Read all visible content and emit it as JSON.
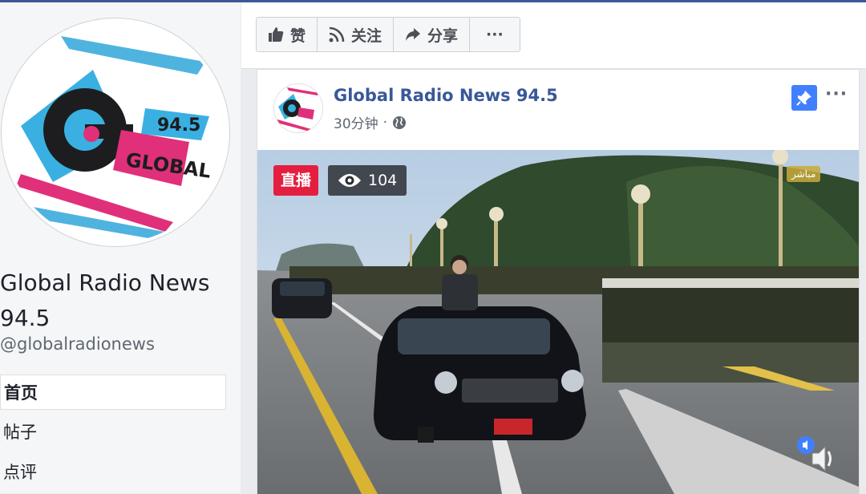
{
  "page": {
    "name": "Global Radio News 94.5",
    "handle": "@globalradionews",
    "logo_text": "GLOBAL",
    "logo_number": "94.5"
  },
  "nav": {
    "items": [
      {
        "label": "首页",
        "active": true
      },
      {
        "label": "帖子",
        "active": false
      },
      {
        "label": "点评",
        "active": false
      }
    ]
  },
  "actions": {
    "like": "赞",
    "follow": "关注",
    "share": "分享",
    "more": "···"
  },
  "post": {
    "author": "Global Radio News 94.5",
    "time": "30分钟",
    "privacy_icon": "globe-icon",
    "more": "···"
  },
  "video": {
    "live_label": "直播",
    "view_count": "104",
    "channel_bug": "مباشر"
  },
  "colors": {
    "brand_blue": "#3b5998",
    "link_blue": "#385898",
    "live_red": "#e41e3f",
    "pin_blue": "#4080ff"
  }
}
